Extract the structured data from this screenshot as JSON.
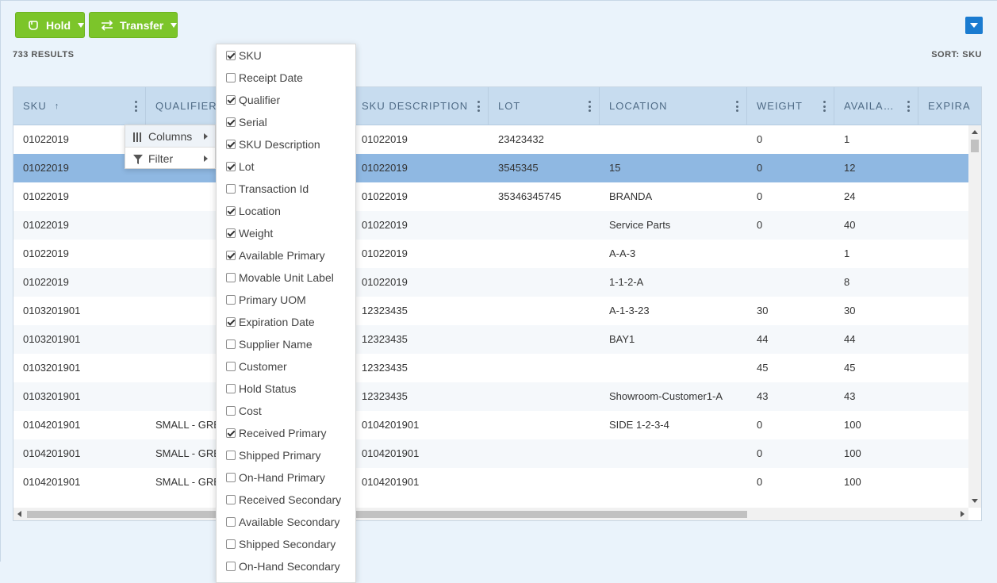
{
  "toolbar": {
    "hold_label": "Hold",
    "transfer_label": "Transfer"
  },
  "summary": {
    "results": "733 RESULTS",
    "sort": "SORT: SKU"
  },
  "grid": {
    "columns": [
      "SKU",
      "QUALIFIER",
      "SKU DESCRIPTION",
      "LOT",
      "LOCATION",
      "WEIGHT",
      "AVAILA…",
      "EXPIRA"
    ],
    "sort_indicator": "↑",
    "rows": [
      [
        "01022019",
        "",
        "01022019",
        "23423432",
        "",
        "0",
        "1"
      ],
      [
        "01022019",
        "",
        "01022019",
        "3545345",
        "15",
        "0",
        "12"
      ],
      [
        "01022019",
        "",
        "01022019",
        "35346345745",
        "BRANDA",
        "0",
        "24"
      ],
      [
        "01022019",
        "",
        "01022019",
        "",
        "Service Parts",
        "0",
        "40"
      ],
      [
        "01022019",
        "",
        "01022019",
        "",
        "A-A-3",
        "",
        "1"
      ],
      [
        "01022019",
        "",
        "01022019",
        "",
        "1-1-2-A",
        "",
        "8"
      ],
      [
        "0103201901",
        "",
        "12323435",
        "",
        "A-1-3-23",
        "30",
        "30"
      ],
      [
        "0103201901",
        "",
        "12323435",
        "",
        "BAY1",
        "44",
        "44"
      ],
      [
        "0103201901",
        "",
        "12323435",
        "",
        "",
        "45",
        "45"
      ],
      [
        "0103201901",
        "",
        "12323435",
        "",
        "Showroom-Customer1-A",
        "43",
        "43"
      ],
      [
        "0104201901",
        "SMALL - GRE",
        "0104201901",
        "",
        "SIDE 1-2-3-4",
        "0",
        "100"
      ],
      [
        "0104201901",
        "SMALL - GRE",
        "0104201901",
        "",
        "",
        "0",
        "100"
      ],
      [
        "0104201901",
        "SMALL - GRE",
        "0104201901",
        "",
        "",
        "0",
        "100"
      ]
    ],
    "selected_row": 2
  },
  "context_menu": {
    "items": [
      {
        "label": "Columns",
        "icon": "columns-icon"
      },
      {
        "label": "Filter",
        "icon": "filter-icon"
      }
    ]
  },
  "columns_panel": {
    "items": [
      {
        "label": "SKU",
        "checked": true
      },
      {
        "label": "Receipt Date",
        "checked": false
      },
      {
        "label": "Qualifier",
        "checked": true
      },
      {
        "label": "Serial",
        "checked": true
      },
      {
        "label": "SKU Description",
        "checked": true
      },
      {
        "label": "Lot",
        "checked": true
      },
      {
        "label": "Transaction Id",
        "checked": false
      },
      {
        "label": "Location",
        "checked": true
      },
      {
        "label": "Weight",
        "checked": true
      },
      {
        "label": "Available Primary",
        "checked": true
      },
      {
        "label": "Movable Unit Label",
        "checked": false
      },
      {
        "label": "Primary UOM",
        "checked": false
      },
      {
        "label": "Expiration Date",
        "checked": true
      },
      {
        "label": "Supplier Name",
        "checked": false
      },
      {
        "label": "Customer",
        "checked": false
      },
      {
        "label": "Hold Status",
        "checked": false
      },
      {
        "label": "Cost",
        "checked": false
      },
      {
        "label": "Received Primary",
        "checked": true
      },
      {
        "label": "Shipped Primary",
        "checked": false
      },
      {
        "label": "On-Hand Primary",
        "checked": false
      },
      {
        "label": "Received Secondary",
        "checked": false
      },
      {
        "label": "Available Secondary",
        "checked": false
      },
      {
        "label": "Shipped Secondary",
        "checked": false
      },
      {
        "label": "On-Hand Secondary",
        "checked": false
      }
    ]
  },
  "colors": {
    "button_green": "#7cc52a",
    "accent_blue": "#1a7bd0",
    "header_bg": "#c7dcef",
    "selected_row": "#8fb8e2"
  }
}
